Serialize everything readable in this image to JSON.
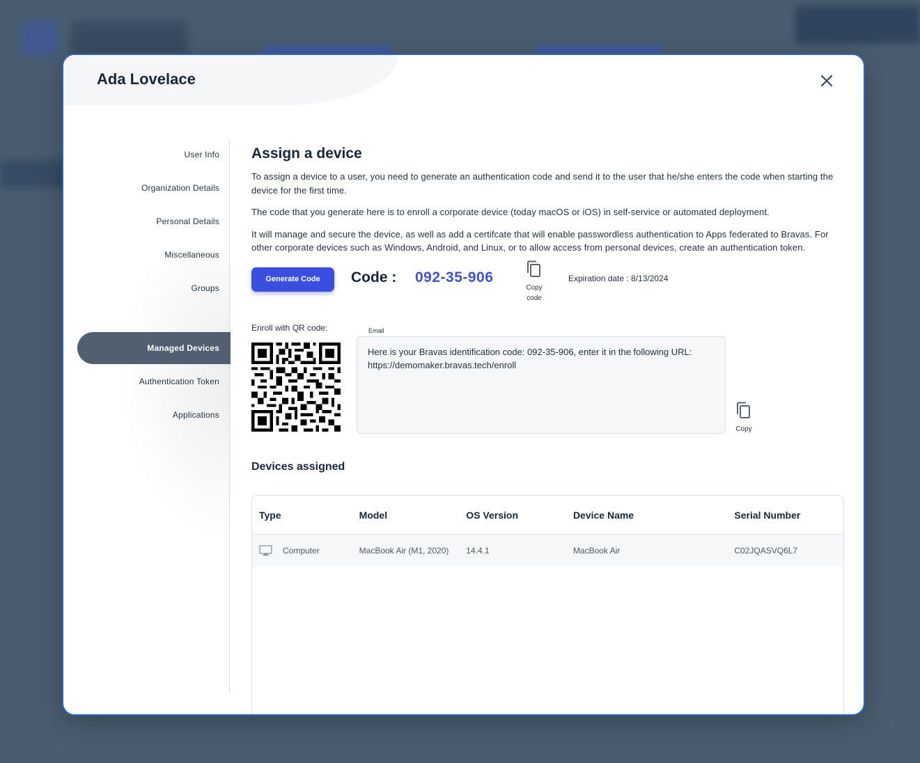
{
  "modal": {
    "title": "Ada Lovelace"
  },
  "sidebar": {
    "items": [
      {
        "label": "User Info"
      },
      {
        "label": "Organization Details"
      },
      {
        "label": "Personal Details"
      },
      {
        "label": "Miscellaneous"
      },
      {
        "label": "Groups"
      },
      {
        "label": "Managed Devices",
        "active": true
      },
      {
        "label": "Authentication Token"
      },
      {
        "label": "Applications"
      }
    ]
  },
  "assign": {
    "title": "Assign a device",
    "para1": "To assign a device to a user, you need to generate an authentication code and send it to the user that he/she enters the code when starting the device for the first time.",
    "para2": "The code that you generate here is to enroll a corporate device (today macOS or iOS) in self-service or automated deployment.",
    "para3": "It will manage and secure the device, as well as add a certifcate that will enable passwordless authentication to Apps federated to Bravas. For other corporate devices such as Windows, Android, and Linux, or to allow access from personal devices, create an authentication token.",
    "generate_label": "Generate Code",
    "code_label": "Code :",
    "code_value": "092-35-906",
    "copy_code_line1": "Copy",
    "copy_code_line2": "code",
    "expiration": "Expiration date : 8/13/2024",
    "qr_label": "Enroll with QR code:",
    "email_label": "Email",
    "email_text": "Here is your Bravas identification code: 092-35-906, enter it in the following URL: https://demomaker.bravas.tech/enroll",
    "copy_label": "Copy"
  },
  "devices": {
    "title": "Devices assigned",
    "columns": [
      "Type",
      "Model",
      "OS Version",
      "Device Name",
      "Serial Number"
    ],
    "rows": [
      {
        "type": "Computer",
        "model": "MacBook Air (M1, 2020)",
        "os": "14.4.1",
        "name": "MacBook Air",
        "serial": "C02JQASVQ6L7"
      }
    ]
  },
  "colors": {
    "accent": "#3a4fe0",
    "code": "#3f52d6",
    "active_nav": "#515f70",
    "backdrop": "#4a5d70"
  },
  "icons": {
    "close": "close-icon",
    "copy": "copy-icon",
    "computer": "computer-icon"
  }
}
